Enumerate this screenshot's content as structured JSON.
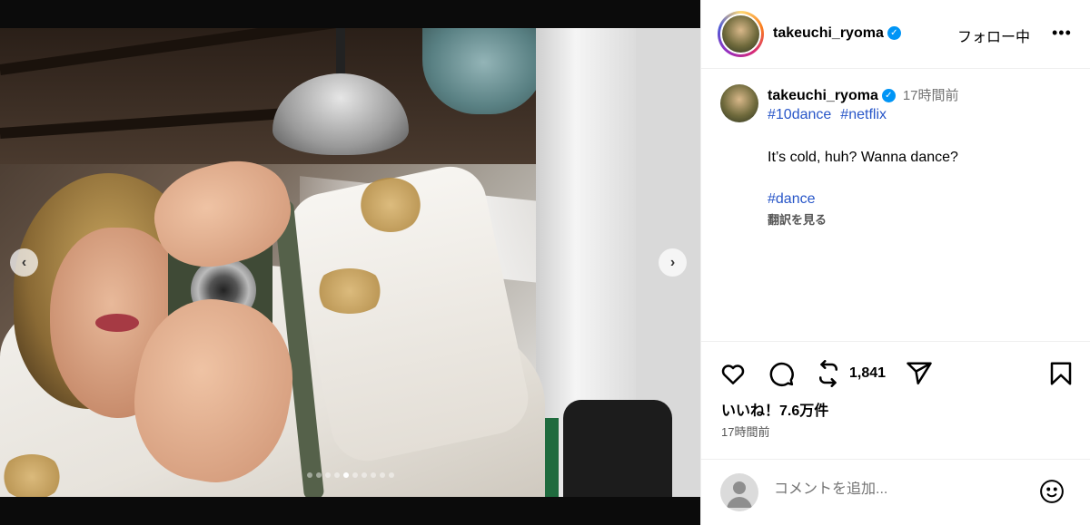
{
  "header": {
    "username": "takeuchi_ryoma",
    "follow_status": "フォロー中",
    "more": "•••"
  },
  "caption": {
    "username": "takeuchi_ryoma",
    "time_ago": "17時間前",
    "hashtags": [
      "#10dance",
      "#netflix"
    ],
    "text": "It’s cold, huh? Wanna dance?",
    "hashtag_footer": "#dance",
    "translate": "翻訳を見る"
  },
  "carousel": {
    "prev": "‹",
    "next": "›",
    "slide_count": 10,
    "active_index": 4
  },
  "actions": {
    "repost_count": "1,841",
    "likes": "いいね！7.6万件",
    "post_time": "17時間前"
  },
  "comment": {
    "placeholder": "コメントを追加..."
  },
  "icons": {
    "like": "heart-icon",
    "comment": "comment-icon",
    "repost": "repost-icon",
    "share": "send-icon",
    "save": "bookmark-icon",
    "emoji": "emoji-icon",
    "verified": "verified-badge-icon"
  },
  "colors": {
    "link": "#2856c8",
    "verified": "#0095f6",
    "muted": "#737373"
  }
}
